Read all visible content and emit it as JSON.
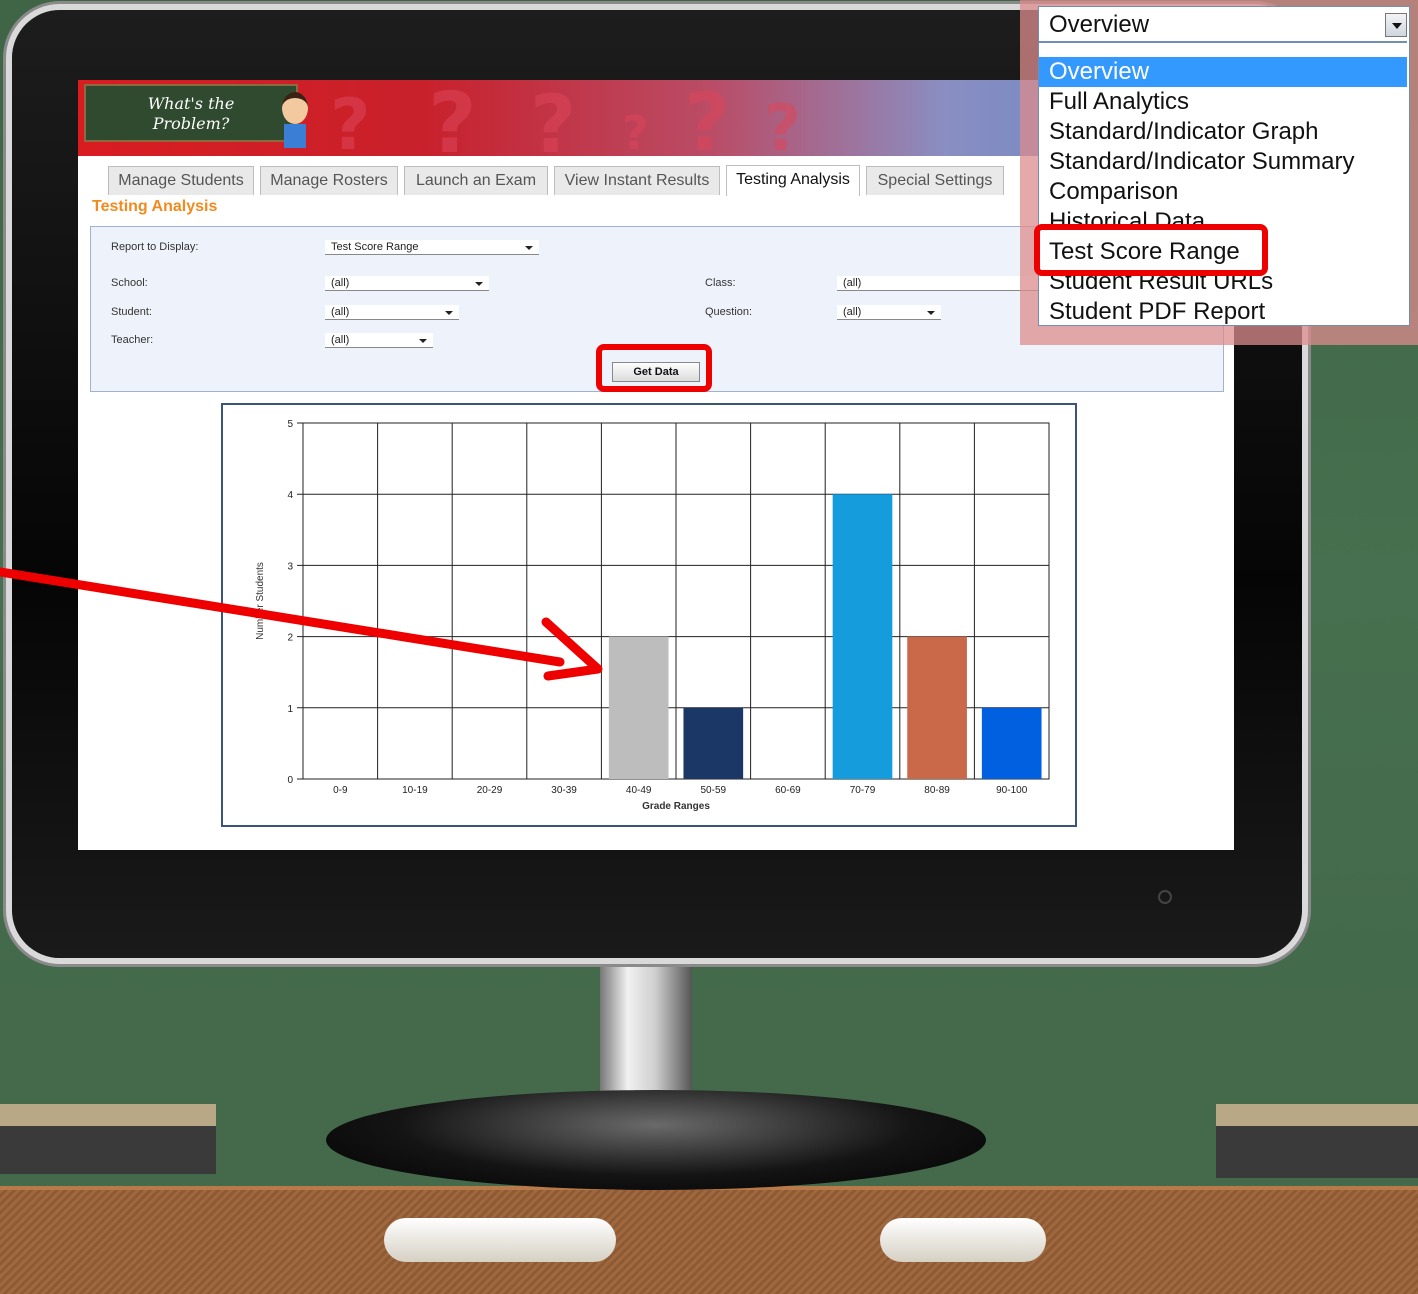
{
  "app": {
    "logo_text_line1": "What's the",
    "logo_text_line2": "Problem?"
  },
  "tabs": [
    "Manage Students",
    "Manage Rosters",
    "Launch an Exam",
    "View Instant Results",
    "Testing Analysis",
    "Special Settings"
  ],
  "active_tab": "Testing Analysis",
  "page_title": "Testing Analysis",
  "form": {
    "report_label": "Report to Display:",
    "report_value": "Test Score Range",
    "school_label": "School:",
    "school_value": "(all)",
    "class_label": "Class:",
    "class_value": "(all)",
    "student_label": "Student:",
    "student_value": "(all)",
    "question_label": "Question:",
    "question_value": "(all)",
    "teacher_label": "Teacher:",
    "teacher_value": "(all)",
    "get_data_label": "Get Data"
  },
  "dropdown": {
    "current": "Overview",
    "options": [
      "Overview",
      "Full Analytics",
      "Standard/Indicator Graph",
      "Standard/Indicator Summary",
      "Comparison",
      "Historical Data",
      "Test Score Range",
      "Student Result URLs",
      "Student PDF Report"
    ],
    "highlighted": "Test Score Range"
  },
  "colors": {
    "highlight": "#e00000",
    "orange_title": "#f28a1e",
    "selected_option": "#3399ff"
  },
  "chart_data": {
    "type": "bar",
    "xlabel": "Grade Ranges",
    "ylabel": "Number Students",
    "categories": [
      "0-9",
      "10-19",
      "20-29",
      "30-39",
      "40-49",
      "50-59",
      "60-69",
      "70-79",
      "80-89",
      "90-100"
    ],
    "values": [
      0,
      0,
      0,
      0,
      2,
      1,
      0,
      4,
      2,
      1
    ],
    "bar_colors": [
      "#bdbdbd",
      "#bdbdbd",
      "#bdbdbd",
      "#bdbdbd",
      "#bdbdbd",
      "#1a3766",
      "#bdbdbd",
      "#149cdd",
      "#c9694a",
      "#0060df"
    ],
    "ylim": [
      0,
      5
    ],
    "yticks": [
      0,
      1,
      2,
      3,
      4,
      5
    ],
    "grid": true
  }
}
